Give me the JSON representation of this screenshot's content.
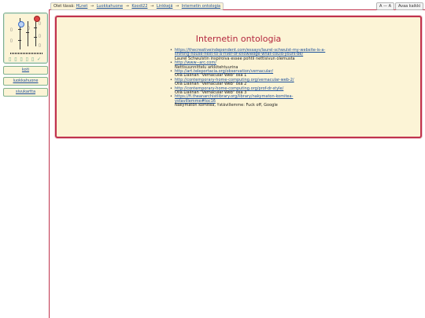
{
  "breadcrumb": {
    "prefix": "Olet tässä:",
    "items": [
      "HLnet",
      "Luokkahuone",
      "Koodi22",
      "Linkkejä",
      "Internetin ontologia"
    ]
  },
  "top_buttons": {
    "font_size": "A — A",
    "close_all": "Avaa kaikki"
  },
  "nav": {
    "items": [
      {
        "label": "koti"
      },
      {
        "label": "luokkahuone"
      },
      {
        "label": "sivukartta"
      }
    ]
  },
  "page": {
    "title": "Internetin ontologia",
    "links": [
      {
        "url": "https://thecreativeindependent.com/essays/laurel-schwulst-my-website-is-a-shifting-house-next-to-a-river-of-knowledge-what-could-yours-be/",
        "description": "Laurel Schwulstin inspiroiva essee pohtii nettisivun olemusta"
      },
      {
        "url": "http://www--arc.com/",
        "description": "Nettisuunnittelu arkkitehtuurina"
      },
      {
        "url": "http://art.teleportacia.org/observation/vernacular/",
        "description": "Olia Lialinan \"Vernacular Web\" osa 1"
      },
      {
        "url": "http://contemporary-home-computing.org/vernacular-web-2/",
        "description": "Olia Lialinan \"Vernacular Web\" osa 2"
      },
      {
        "url": "http://contemporary-home-computing.org/prof-dr-style/",
        "description": "Olia Lialinan \"Vernacular Web\" osa 3"
      },
      {
        "url": "https://fi.theanarchistlibrary.org/library/nakymaton-komitea-ystavillemme#toc16",
        "description": "Näkymätön komitea, Ystävillemme: Fuck off, Google"
      }
    ]
  }
}
